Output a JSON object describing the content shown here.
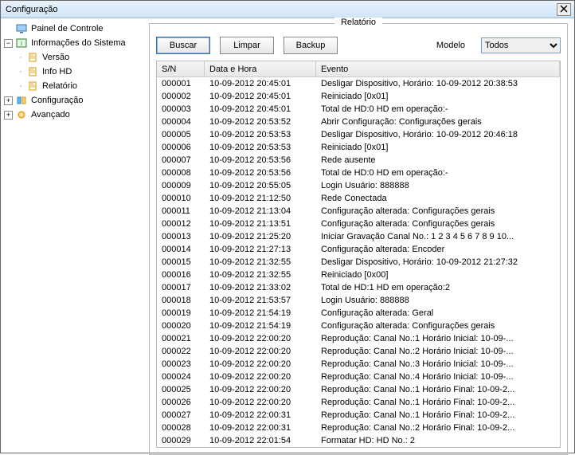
{
  "window": {
    "title": "Configuração"
  },
  "tree": {
    "control_panel": "Painel de Controle",
    "system_info": "Informações do Sistema",
    "version": "Versão",
    "info_hd": "Info HD",
    "report": "Relatório",
    "config": "Configuração",
    "advanced": "Avançado"
  },
  "group": {
    "title": "Relatório"
  },
  "toolbar": {
    "search": "Buscar",
    "clear": "Limpar",
    "backup": "Backup",
    "model_label": "Modelo",
    "model_selected": "Todos"
  },
  "columns": {
    "sn": "S/N",
    "datetime": "Data e Hora",
    "event": "Evento"
  },
  "rows": [
    {
      "sn": "000001",
      "dt": "10-09-2012 20:45:01",
      "ev": "Desligar Dispositivo, Horário: 10-09-2012 20:38:53"
    },
    {
      "sn": "000002",
      "dt": "10-09-2012 20:45:01",
      "ev": "Reiniciado [0x01]"
    },
    {
      "sn": "000003",
      "dt": "10-09-2012 20:45:01",
      "ev": "Total de HD:0 HD em operação:-"
    },
    {
      "sn": "000004",
      "dt": "10-09-2012 20:53:52",
      "ev": "Abrir Configuração: Configurações gerais"
    },
    {
      "sn": "000005",
      "dt": "10-09-2012 20:53:53",
      "ev": "Desligar Dispositivo, Horário: 10-09-2012 20:46:18"
    },
    {
      "sn": "000006",
      "dt": "10-09-2012 20:53:53",
      "ev": "Reiniciado [0x01]"
    },
    {
      "sn": "000007",
      "dt": "10-09-2012 20:53:56",
      "ev": "Rede ausente"
    },
    {
      "sn": "000008",
      "dt": "10-09-2012 20:53:56",
      "ev": "Total de HD:0 HD em operação:-"
    },
    {
      "sn": "000009",
      "dt": "10-09-2012 20:55:05",
      "ev": "Login Usuário: 888888"
    },
    {
      "sn": "000010",
      "dt": "10-09-2012 21:12:50",
      "ev": "Rede Conectada"
    },
    {
      "sn": "000011",
      "dt": "10-09-2012 21:13:04",
      "ev": "Configuração alterada: Configurações gerais"
    },
    {
      "sn": "000012",
      "dt": "10-09-2012 21:13:51",
      "ev": "Configuração alterada: Configurações gerais"
    },
    {
      "sn": "000013",
      "dt": "10-09-2012 21:25:20",
      "ev": "Iniciar Gravação Canal No.: 1 2 3 4 5 6 7 8 9 10..."
    },
    {
      "sn": "000014",
      "dt": "10-09-2012 21:27:13",
      "ev": "Configuração alterada: Encoder"
    },
    {
      "sn": "000015",
      "dt": "10-09-2012 21:32:55",
      "ev": "Desligar Dispositivo, Horário: 10-09-2012 21:27:32"
    },
    {
      "sn": "000016",
      "dt": "10-09-2012 21:32:55",
      "ev": "Reiniciado [0x00]"
    },
    {
      "sn": "000017",
      "dt": "10-09-2012 21:33:02",
      "ev": "Total de HD:1 HD em operação:2"
    },
    {
      "sn": "000018",
      "dt": "10-09-2012 21:53:57",
      "ev": "Login Usuário: 888888"
    },
    {
      "sn": "000019",
      "dt": "10-09-2012 21:54:19",
      "ev": "Configuração alterada: Geral"
    },
    {
      "sn": "000020",
      "dt": "10-09-2012 21:54:19",
      "ev": "Configuração alterada: Configurações gerais"
    },
    {
      "sn": "000021",
      "dt": "10-09-2012 22:00:20",
      "ev": "Reprodução: Canal No.:1  Horário Inicial: 10-09-..."
    },
    {
      "sn": "000022",
      "dt": "10-09-2012 22:00:20",
      "ev": "Reprodução: Canal No.:2  Horário Inicial: 10-09-..."
    },
    {
      "sn": "000023",
      "dt": "10-09-2012 22:00:20",
      "ev": "Reprodução: Canal No.:3  Horário Inicial: 10-09-..."
    },
    {
      "sn": "000024",
      "dt": "10-09-2012 22:00:20",
      "ev": "Reprodução: Canal No.:4  Horário Inicial: 10-09-..."
    },
    {
      "sn": "000025",
      "dt": "10-09-2012 22:00:20",
      "ev": "Reprodução: Canal No.:1  Horário Final: 10-09-2..."
    },
    {
      "sn": "000026",
      "dt": "10-09-2012 22:00:20",
      "ev": "Reprodução: Canal No.:1  Horário Final: 10-09-2..."
    },
    {
      "sn": "000027",
      "dt": "10-09-2012 22:00:31",
      "ev": "Reprodução: Canal No.:1  Horário Final: 10-09-2..."
    },
    {
      "sn": "000028",
      "dt": "10-09-2012 22:00:31",
      "ev": "Reprodução: Canal No.:2  Horário Final: 10-09-2..."
    },
    {
      "sn": "000029",
      "dt": "10-09-2012 22:01:54",
      "ev": "Formatar HD: HD No.: 2"
    }
  ]
}
